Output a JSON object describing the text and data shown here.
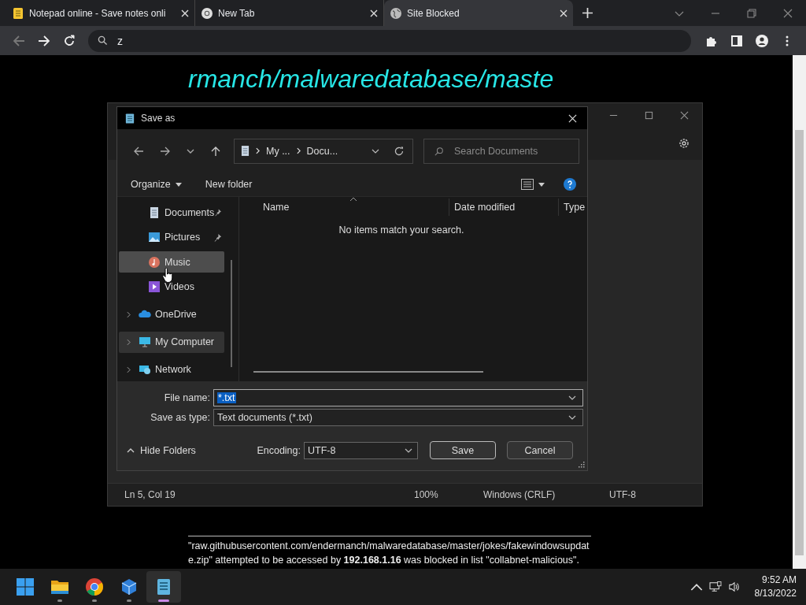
{
  "browser": {
    "tabs": [
      {
        "title": "Notepad online - Save notes onli",
        "selected": false
      },
      {
        "title": "New Tab",
        "selected": false
      },
      {
        "title": "Site Blocked",
        "selected": true
      }
    ],
    "address": "z"
  },
  "page": {
    "heading_fragment": "rmanch/malwaredatabase/maste",
    "message": "\"raw.githubusercontent.com/endermanch/malwaredatabase/master/jokes/fakewindowsupdate.zip\" attempted to be accessed by **192.168.1.16** was blocked in list \"collabnet-malicious\"."
  },
  "notepad": {
    "status_bar": [
      "Ln 5, Col 19",
      "100%",
      "Windows (CRLF)",
      "UTF-8"
    ]
  },
  "dialog": {
    "title": "Save as",
    "breadcrumb": [
      "My ...",
      "Docu..."
    ],
    "search": {
      "placeholder": "Search Documents"
    },
    "commands": [
      "Organize",
      "New folder"
    ],
    "nav": [
      {
        "label": "Documents",
        "kind": "quick",
        "pinned": true,
        "selected": false,
        "hovered": false
      },
      {
        "label": "Pictures",
        "kind": "quick",
        "pinned": true,
        "selected": false,
        "hovered": false
      },
      {
        "label": "Music",
        "kind": "quick",
        "pinned": false,
        "selected": false,
        "hovered": true
      },
      {
        "label": "Videos",
        "kind": "quick",
        "pinned": false,
        "selected": false,
        "hovered": false
      },
      {
        "label": "OneDrive",
        "kind": "root",
        "pinned": false,
        "selected": false,
        "hovered": false
      },
      {
        "label": "My Computer",
        "kind": "root",
        "pinned": false,
        "selected": true,
        "hovered": false
      },
      {
        "label": "Network",
        "kind": "root",
        "pinned": false,
        "selected": false,
        "hovered": false
      }
    ],
    "columns": [
      "Name",
      "Date modified",
      "Type"
    ],
    "empty_message": "No items match your search.",
    "file_name": {
      "label": "File name:",
      "value": "*.txt"
    },
    "save_as_type": {
      "label": "Save as type:",
      "value": "Text documents (*.txt)"
    },
    "hide_folders": "Hide Folders",
    "encoding": {
      "label": "Encoding:",
      "value": "UTF-8"
    },
    "buttons": [
      "Save",
      "Cancel"
    ]
  },
  "taskbar": {
    "apps": [
      {
        "running": false,
        "active": false
      },
      {
        "running": true,
        "active": false
      },
      {
        "running": true,
        "active": false
      },
      {
        "running": true,
        "active": false
      },
      {
        "running": true,
        "active": true
      }
    ],
    "time": "9:52 AM",
    "date": "8/13/2022"
  }
}
